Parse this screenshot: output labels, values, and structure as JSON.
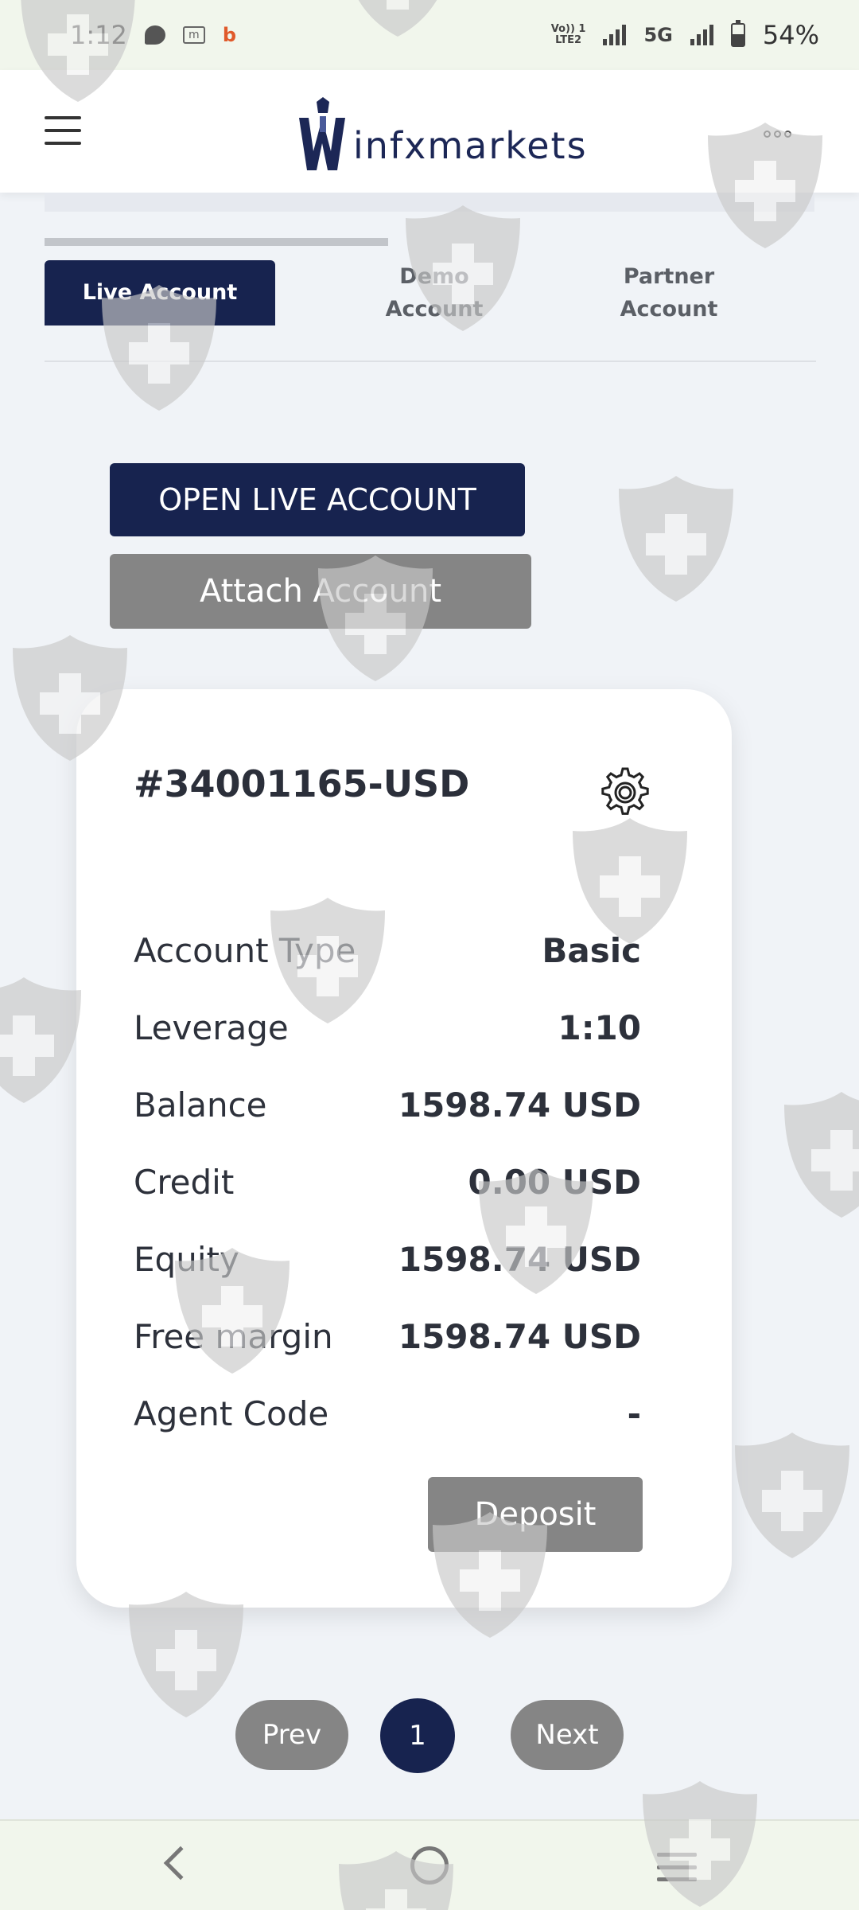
{
  "status_bar": {
    "time": "1:12",
    "network": "5G",
    "volte_line1": "Vo)) 1",
    "volte_line2": "LTE2",
    "battery": "54%",
    "icons": [
      "chat-icon",
      "m-notification-icon",
      "b-notification-icon",
      "volte-icon",
      "signal-icon",
      "battery-icon"
    ]
  },
  "header": {
    "logo_text": "infxmarkets",
    "icons": [
      "hamburger-menu-icon",
      "more-options-icon"
    ]
  },
  "tabs": [
    {
      "label": "Live Account",
      "active": true
    },
    {
      "label_line1": "Demo",
      "label_line2": "Account",
      "active": false
    },
    {
      "label_line1": "Partner",
      "label_line2": "Account",
      "active": false
    }
  ],
  "actions": {
    "open_live_account": "OPEN LIVE ACCOUNT",
    "attach_account": "Attach Account"
  },
  "account": {
    "number": "#34001165-USD",
    "rows": [
      {
        "label": "Account Type",
        "value": "Basic"
      },
      {
        "label": "Leverage",
        "value": "1:10"
      },
      {
        "label": "Balance",
        "value": "1598.74 USD"
      },
      {
        "label": "Credit",
        "value": "0.00 USD"
      },
      {
        "label": "Equity",
        "value": "1598.74 USD"
      },
      {
        "label": "Free margin",
        "value": "1598.74 USD"
      },
      {
        "label": "Agent Code",
        "value": "-"
      }
    ],
    "deposit_label": "Deposit"
  },
  "pagination": {
    "prev": "Prev",
    "current": "1",
    "next": "Next"
  },
  "colors": {
    "primary": "#17234f",
    "disabled_button": "#858585",
    "background": "#f0f3f7"
  }
}
